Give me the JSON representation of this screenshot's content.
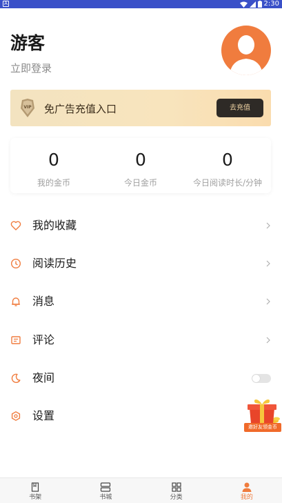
{
  "status_bar": {
    "app_badge": "A",
    "time": "2:30"
  },
  "profile": {
    "username": "游客",
    "login_link": "立即登录"
  },
  "vip_banner": {
    "text": "免广告充值入口",
    "button_label": "去充值",
    "vip_badge": "VIP"
  },
  "stats": [
    {
      "value": "0",
      "label": "我的金币"
    },
    {
      "value": "0",
      "label": "今日金币"
    },
    {
      "value": "0",
      "label": "今日阅读时长/分钟"
    }
  ],
  "menu": [
    {
      "label": "我的收藏",
      "icon": "heart-icon"
    },
    {
      "label": "阅读历史",
      "icon": "clock-icon"
    },
    {
      "label": "消息",
      "icon": "bell-icon"
    },
    {
      "label": "评论",
      "icon": "comment-icon"
    },
    {
      "label": "夜间",
      "icon": "moon-icon",
      "toggle_on": false
    },
    {
      "label": "设置",
      "icon": "settings-icon"
    }
  ],
  "gift": {
    "label": "邀好友领金币"
  },
  "bottom_nav": [
    {
      "label": "书架",
      "icon": "bookshelf-icon",
      "active": false
    },
    {
      "label": "书城",
      "icon": "bookstore-icon",
      "active": false
    },
    {
      "label": "分类",
      "icon": "category-icon",
      "active": false
    },
    {
      "label": "我的",
      "icon": "profile-icon",
      "active": true
    }
  ],
  "colors": {
    "accent": "#f07c3e",
    "status_bar": "#3a50c8",
    "vip_button": "#2e2a26"
  }
}
